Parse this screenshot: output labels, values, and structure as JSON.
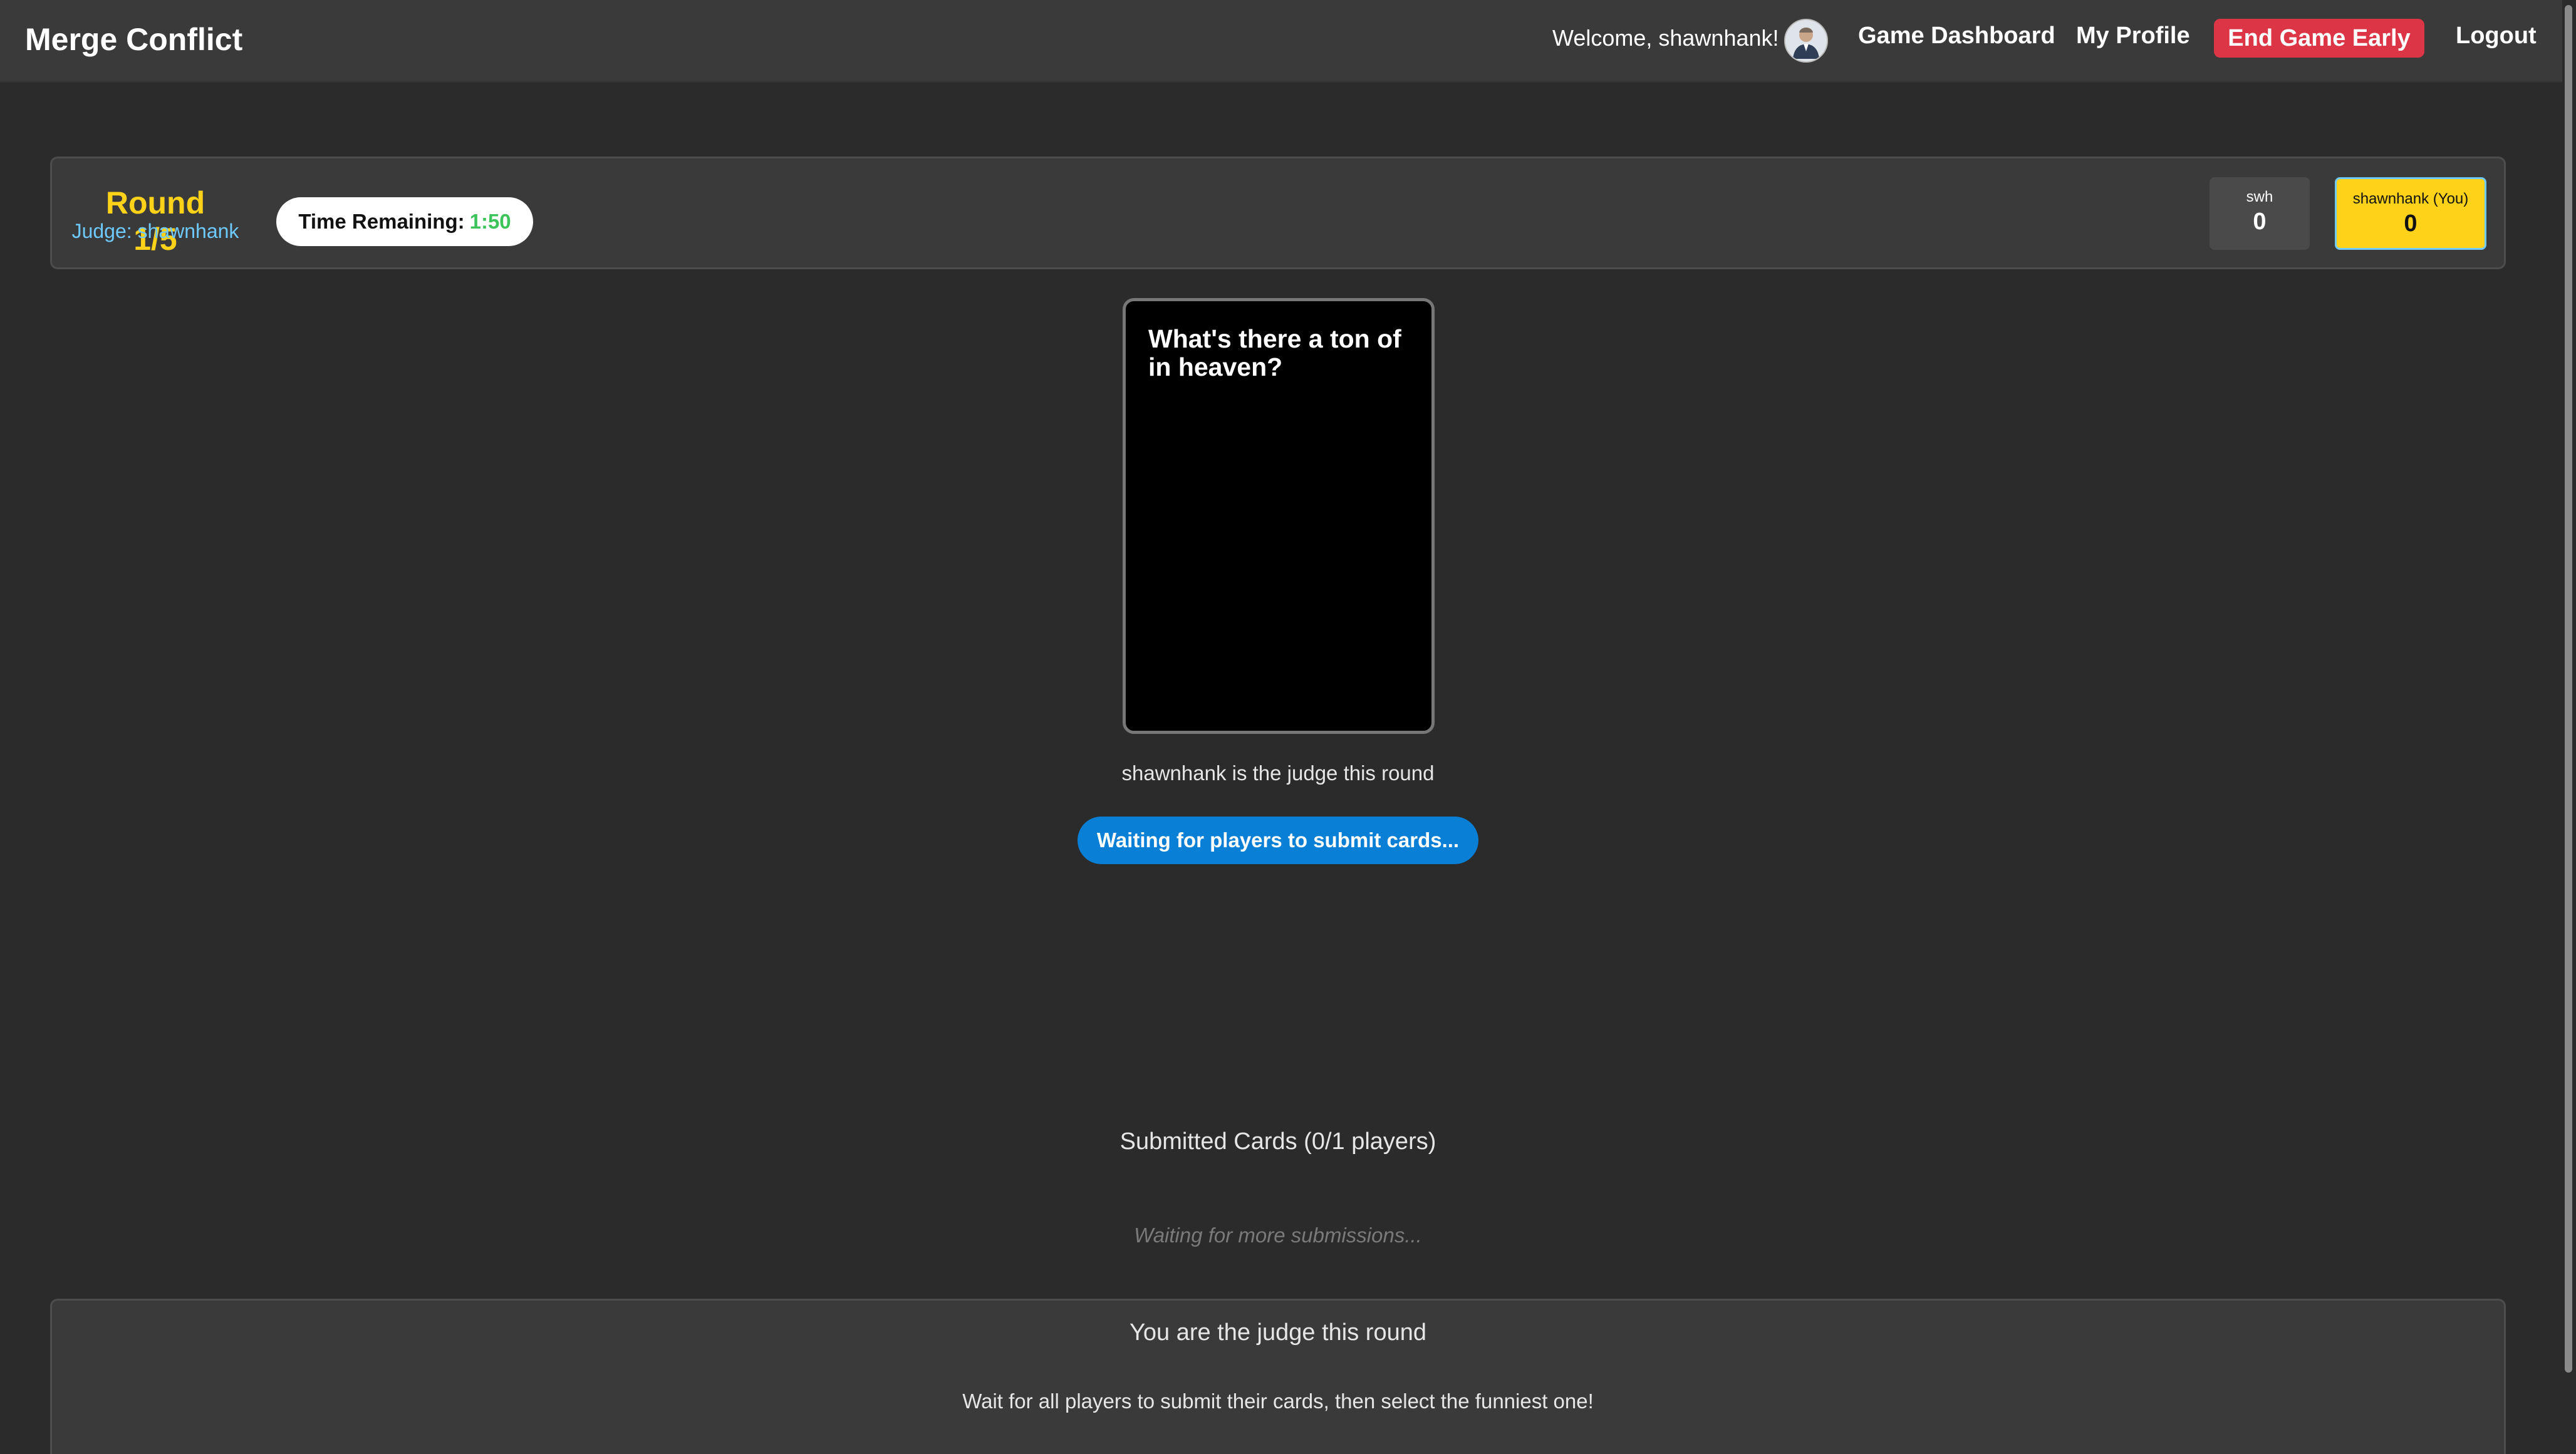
{
  "navbar": {
    "brand": "Merge Conflict",
    "welcome": "Welcome, shawnhank!",
    "links": {
      "dashboard": "Game Dashboard",
      "profile": "My Profile",
      "end_game": "End Game Early",
      "logout": "Logout"
    }
  },
  "round": {
    "title": "Round 1/5",
    "judge_label": "Judge: shawnhank",
    "timer_label": "Time Remaining:",
    "timer_value": "1:50"
  },
  "scores": [
    {
      "name": "swh",
      "score": "0"
    },
    {
      "name": "shawnhank (You)",
      "score": "0"
    }
  ],
  "question_card": {
    "text": "What's there a ton of in heaven?"
  },
  "status": {
    "judge_status": "shawnhank is the judge this round",
    "waiting_button": "Waiting for players to submit cards...",
    "submitted_heading": "Submitted Cards (0/1 players)",
    "waiting_more": "Waiting for more submissions..."
  },
  "judge_panel": {
    "title": "You are the judge this round",
    "description": "Wait for all players to submit their cards, then select the funniest one!"
  },
  "colors": {
    "background": "#2b2b2b",
    "panel": "#3a3a3a",
    "accent_yellow": "#ffd21a",
    "judge_blue": "#6ec9ff",
    "timer_green": "#3cc35a",
    "danger": "#dc3545",
    "primary_button": "#0a7fd6"
  }
}
